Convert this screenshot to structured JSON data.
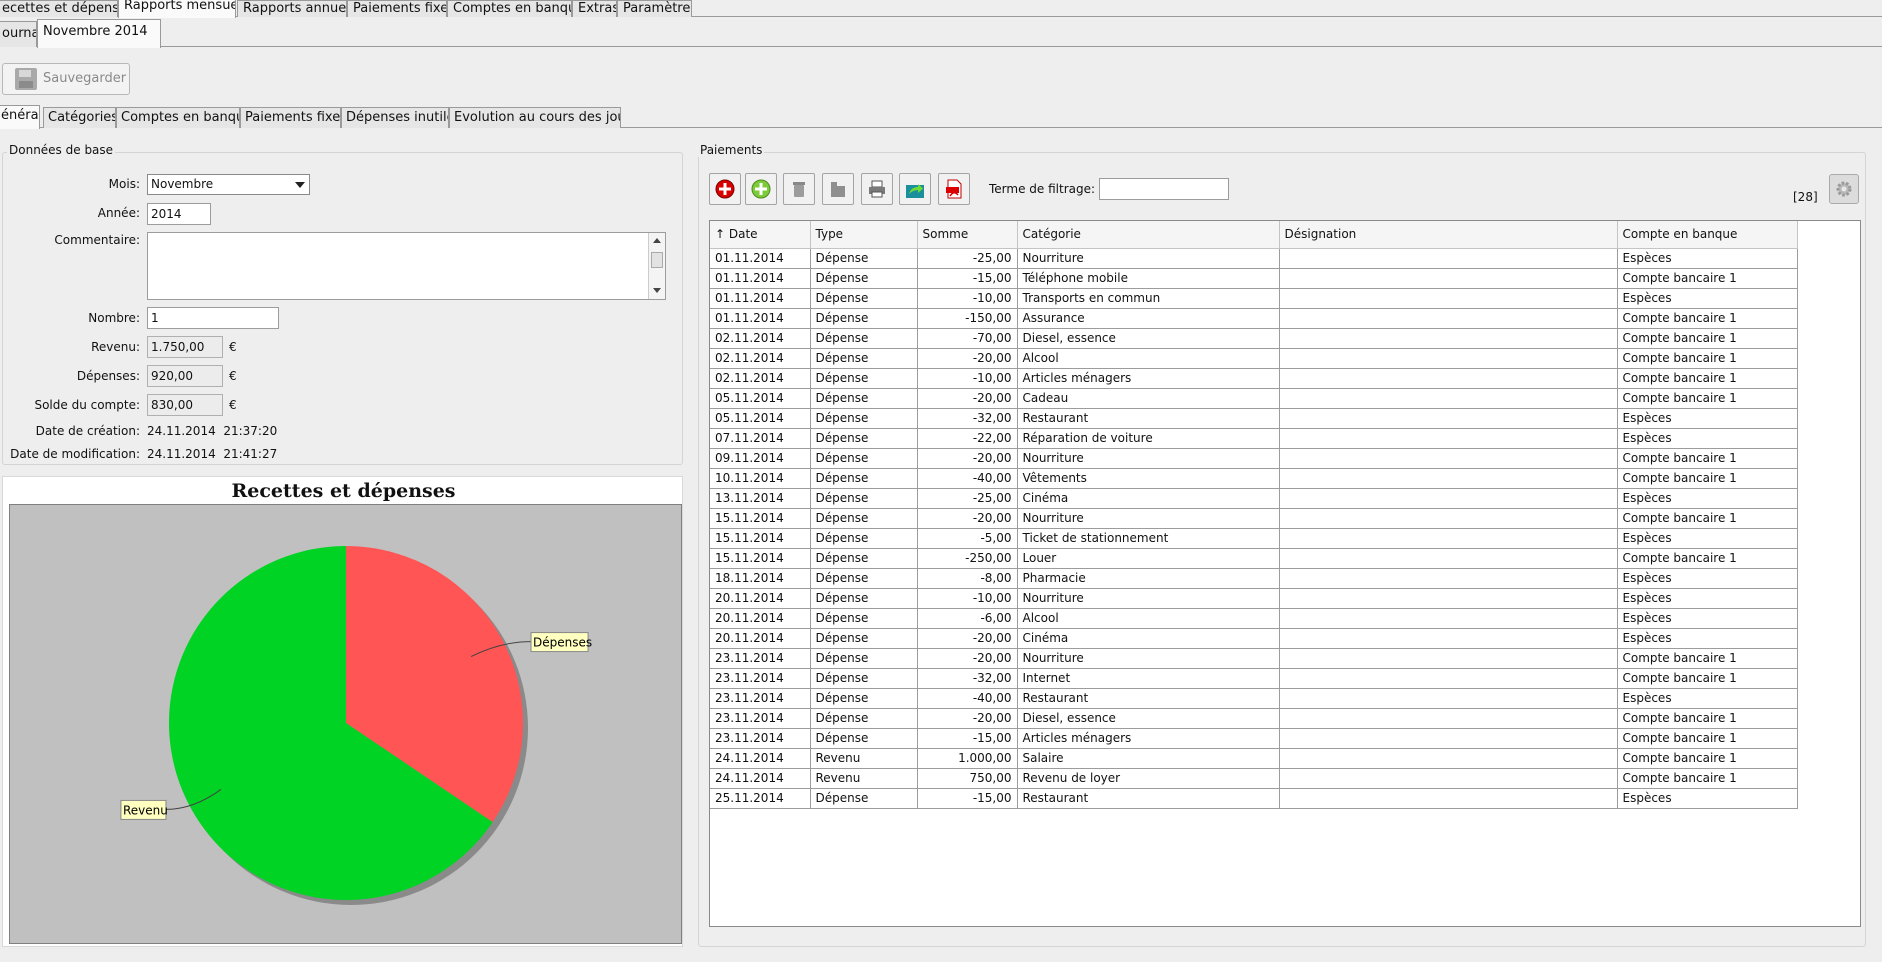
{
  "app": {
    "main_tabs": [
      "ecettes et dépenses",
      "Rapports mensuels",
      "Rapports annuels",
      "Paiements fixes",
      "Comptes en banque",
      "Extras",
      "Paramètres"
    ],
    "sub_tabs": [
      "ournal",
      "Novembre 2014"
    ],
    "save_label": "Sauvegarder",
    "section_tabs": [
      "énéral",
      "Catégories",
      "Comptes en banque",
      "Paiements fixes",
      "Dépenses inutiles",
      "Evolution au cours des jours"
    ]
  },
  "base_data": {
    "title": "Données de base",
    "month_label": "Mois:",
    "month_value": "Novembre",
    "year_label": "Année:",
    "year_value": "2014",
    "comment_label": "Commentaire:",
    "comment_value": "",
    "count_label": "Nombre:",
    "count_value": "1",
    "income_label": "Revenu:",
    "income_value": "1.750,00",
    "expenses_label": "Dépenses:",
    "expenses_value": "920,00",
    "balance_label": "Solde du compte:",
    "balance_value": "830,00",
    "currency": "€",
    "created_label": "Date de création:",
    "created_value": "24.11.2014  21:37:20",
    "modified_label": "Date de modification:",
    "modified_value": "24.11.2014  21:41:27"
  },
  "chart_data": {
    "type": "pie",
    "title": "Recettes et dépenses",
    "slices": [
      {
        "label": "Dépenses",
        "value": 920,
        "color": "#ff5555"
      },
      {
        "label": "Revenu",
        "value": 1750,
        "color": "#00d323"
      }
    ],
    "background": "#c0c0c0"
  },
  "payments": {
    "title": "Paiements",
    "filter_label": "Terme de filtrage:",
    "filter_value": "",
    "count_badge": "[28]",
    "toolbar_icons": [
      "delete-icon",
      "add-icon",
      "trash-icon",
      "clear-icon",
      "print-icon",
      "export-icon",
      "pdf-icon"
    ],
    "columns": [
      "↑ Date",
      "Type",
      "Somme",
      "Catégorie",
      "Désignation",
      "Compte en banque"
    ],
    "rows": [
      [
        "01.11.2014",
        "Dépense",
        "-25,00",
        "Nourriture",
        "",
        "Espèces"
      ],
      [
        "01.11.2014",
        "Dépense",
        "-15,00",
        "Téléphone mobile",
        "",
        "Compte bancaire 1"
      ],
      [
        "01.11.2014",
        "Dépense",
        "-10,00",
        "Transports en commun",
        "",
        "Espèces"
      ],
      [
        "01.11.2014",
        "Dépense",
        "-150,00",
        "Assurance",
        "",
        "Compte bancaire 1"
      ],
      [
        "02.11.2014",
        "Dépense",
        "-70,00",
        "Diesel, essence",
        "",
        "Compte bancaire 1"
      ],
      [
        "02.11.2014",
        "Dépense",
        "-20,00",
        "Alcool",
        "",
        "Compte bancaire 1"
      ],
      [
        "02.11.2014",
        "Dépense",
        "-10,00",
        "Articles ménagers",
        "",
        "Compte bancaire 1"
      ],
      [
        "05.11.2014",
        "Dépense",
        "-20,00",
        "Cadeau",
        "",
        "Compte bancaire 1"
      ],
      [
        "05.11.2014",
        "Dépense",
        "-32,00",
        "Restaurant",
        "",
        "Espèces"
      ],
      [
        "07.11.2014",
        "Dépense",
        "-22,00",
        "Réparation de voiture",
        "",
        "Espèces"
      ],
      [
        "09.11.2014",
        "Dépense",
        "-20,00",
        "Nourriture",
        "",
        "Compte bancaire 1"
      ],
      [
        "10.11.2014",
        "Dépense",
        "-40,00",
        "Vêtements",
        "",
        "Compte bancaire 1"
      ],
      [
        "13.11.2014",
        "Dépense",
        "-25,00",
        "Cinéma",
        "",
        "Espèces"
      ],
      [
        "15.11.2014",
        "Dépense",
        "-20,00",
        "Nourriture",
        "",
        "Compte bancaire 1"
      ],
      [
        "15.11.2014",
        "Dépense",
        "-5,00",
        "Ticket de stationnement",
        "",
        "Espèces"
      ],
      [
        "15.11.2014",
        "Dépense",
        "-250,00",
        "Louer",
        "",
        "Compte bancaire 1"
      ],
      [
        "18.11.2014",
        "Dépense",
        "-8,00",
        "Pharmacie",
        "",
        "Espèces"
      ],
      [
        "20.11.2014",
        "Dépense",
        "-10,00",
        "Nourriture",
        "",
        "Espèces"
      ],
      [
        "20.11.2014",
        "Dépense",
        "-6,00",
        "Alcool",
        "",
        "Espèces"
      ],
      [
        "20.11.2014",
        "Dépense",
        "-20,00",
        "Cinéma",
        "",
        "Espèces"
      ],
      [
        "23.11.2014",
        "Dépense",
        "-20,00",
        "Nourriture",
        "",
        "Compte bancaire 1"
      ],
      [
        "23.11.2014",
        "Dépense",
        "-32,00",
        "Internet",
        "",
        "Compte bancaire 1"
      ],
      [
        "23.11.2014",
        "Dépense",
        "-40,00",
        "Restaurant",
        "",
        "Espèces"
      ],
      [
        "23.11.2014",
        "Dépense",
        "-20,00",
        "Diesel, essence",
        "",
        "Compte bancaire 1"
      ],
      [
        "23.11.2014",
        "Dépense",
        "-15,00",
        "Articles ménagers",
        "",
        "Compte bancaire 1"
      ],
      [
        "24.11.2014",
        "Revenu",
        "1.000,00",
        "Salaire",
        "",
        "Compte bancaire 1"
      ],
      [
        "24.11.2014",
        "Revenu",
        "750,00",
        "Revenu de loyer",
        "",
        "Compte bancaire 1"
      ],
      [
        "25.11.2014",
        "Dépense",
        "-15,00",
        "Restaurant",
        "",
        "Espèces"
      ]
    ]
  }
}
